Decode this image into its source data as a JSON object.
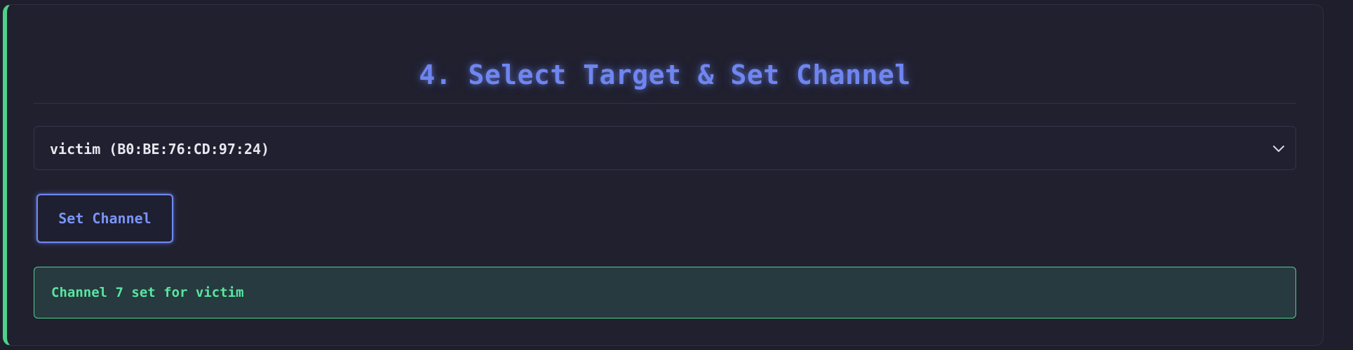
{
  "section": {
    "title": "4. Select Target & Set Channel"
  },
  "target_select": {
    "selected_value": "victim (B0:BE:76:CD:97:24)"
  },
  "actions": {
    "set_channel_label": "Set Channel"
  },
  "status": {
    "message": "Channel 7 set for victim"
  },
  "colors": {
    "accent": "#6f86f0",
    "success": "#4fd08a",
    "background": "#20202f"
  },
  "icons": {
    "dropdown": "chevron-down-icon"
  }
}
